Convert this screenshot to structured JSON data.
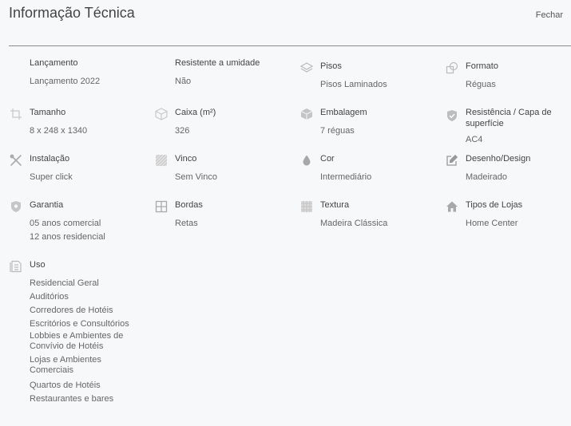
{
  "header": {
    "title": "Informação Técnica",
    "close_label": "Fechar"
  },
  "items": [
    {
      "label": "Lançamento",
      "icon": "none",
      "values": [
        "Lançamento 2022"
      ]
    },
    {
      "label": "Resistente a umidade",
      "icon": "none",
      "values": [
        "Não"
      ]
    },
    {
      "label": "Pisos",
      "icon": "layers-icon",
      "values": [
        "Pisos Laminados"
      ]
    },
    {
      "label": "Formato",
      "icon": "shapes-icon",
      "values": [
        "Réguas"
      ]
    },
    {
      "label": "Tamanho",
      "icon": "crop-icon",
      "values": [
        "8 x 248 x 1340"
      ]
    },
    {
      "label": "Caixa (m²)",
      "icon": "box-icon",
      "values": [
        "326"
      ]
    },
    {
      "label": "Embalagem",
      "icon": "package-icon",
      "values": [
        "7 réguas"
      ]
    },
    {
      "label": "Resistência / Capa de superfície",
      "icon": "shield-check-icon",
      "values": [
        "AC4"
      ]
    },
    {
      "label": "Instalação",
      "icon": "tools-icon",
      "values": [
        "Super click"
      ]
    },
    {
      "label": "Vinco",
      "icon": "texture-icon",
      "values": [
        "Sem Vinco"
      ]
    },
    {
      "label": "Cor",
      "icon": "drop-icon",
      "values": [
        "Intermediário"
      ]
    },
    {
      "label": "Desenho/Design",
      "icon": "edit-icon",
      "values": [
        "Madeirado"
      ]
    },
    {
      "label": "Garantia",
      "icon": "shield-icon",
      "values": [
        "05 anos comercial",
        "12 anos residencial"
      ]
    },
    {
      "label": "Bordas",
      "icon": "grid-icon",
      "values": [
        "Retas"
      ]
    },
    {
      "label": "Textura",
      "icon": "pattern-icon",
      "values": [
        "Madeira Clássica"
      ]
    },
    {
      "label": "Tipos de Lojas",
      "icon": "home-icon",
      "values": [
        "Home Center"
      ]
    },
    {
      "label": "Uso",
      "icon": "document-icon",
      "values": [
        "Residencial Geral",
        "Auditórios",
        "Corredores de Hotéis",
        "Escritórios e Consultórios",
        "Lobbies e Ambientes de Convívio de Hotéis",
        "Lojas e Ambientes Comerciais",
        "Quartos de Hotéis",
        "Restaurantes e bares"
      ]
    }
  ]
}
